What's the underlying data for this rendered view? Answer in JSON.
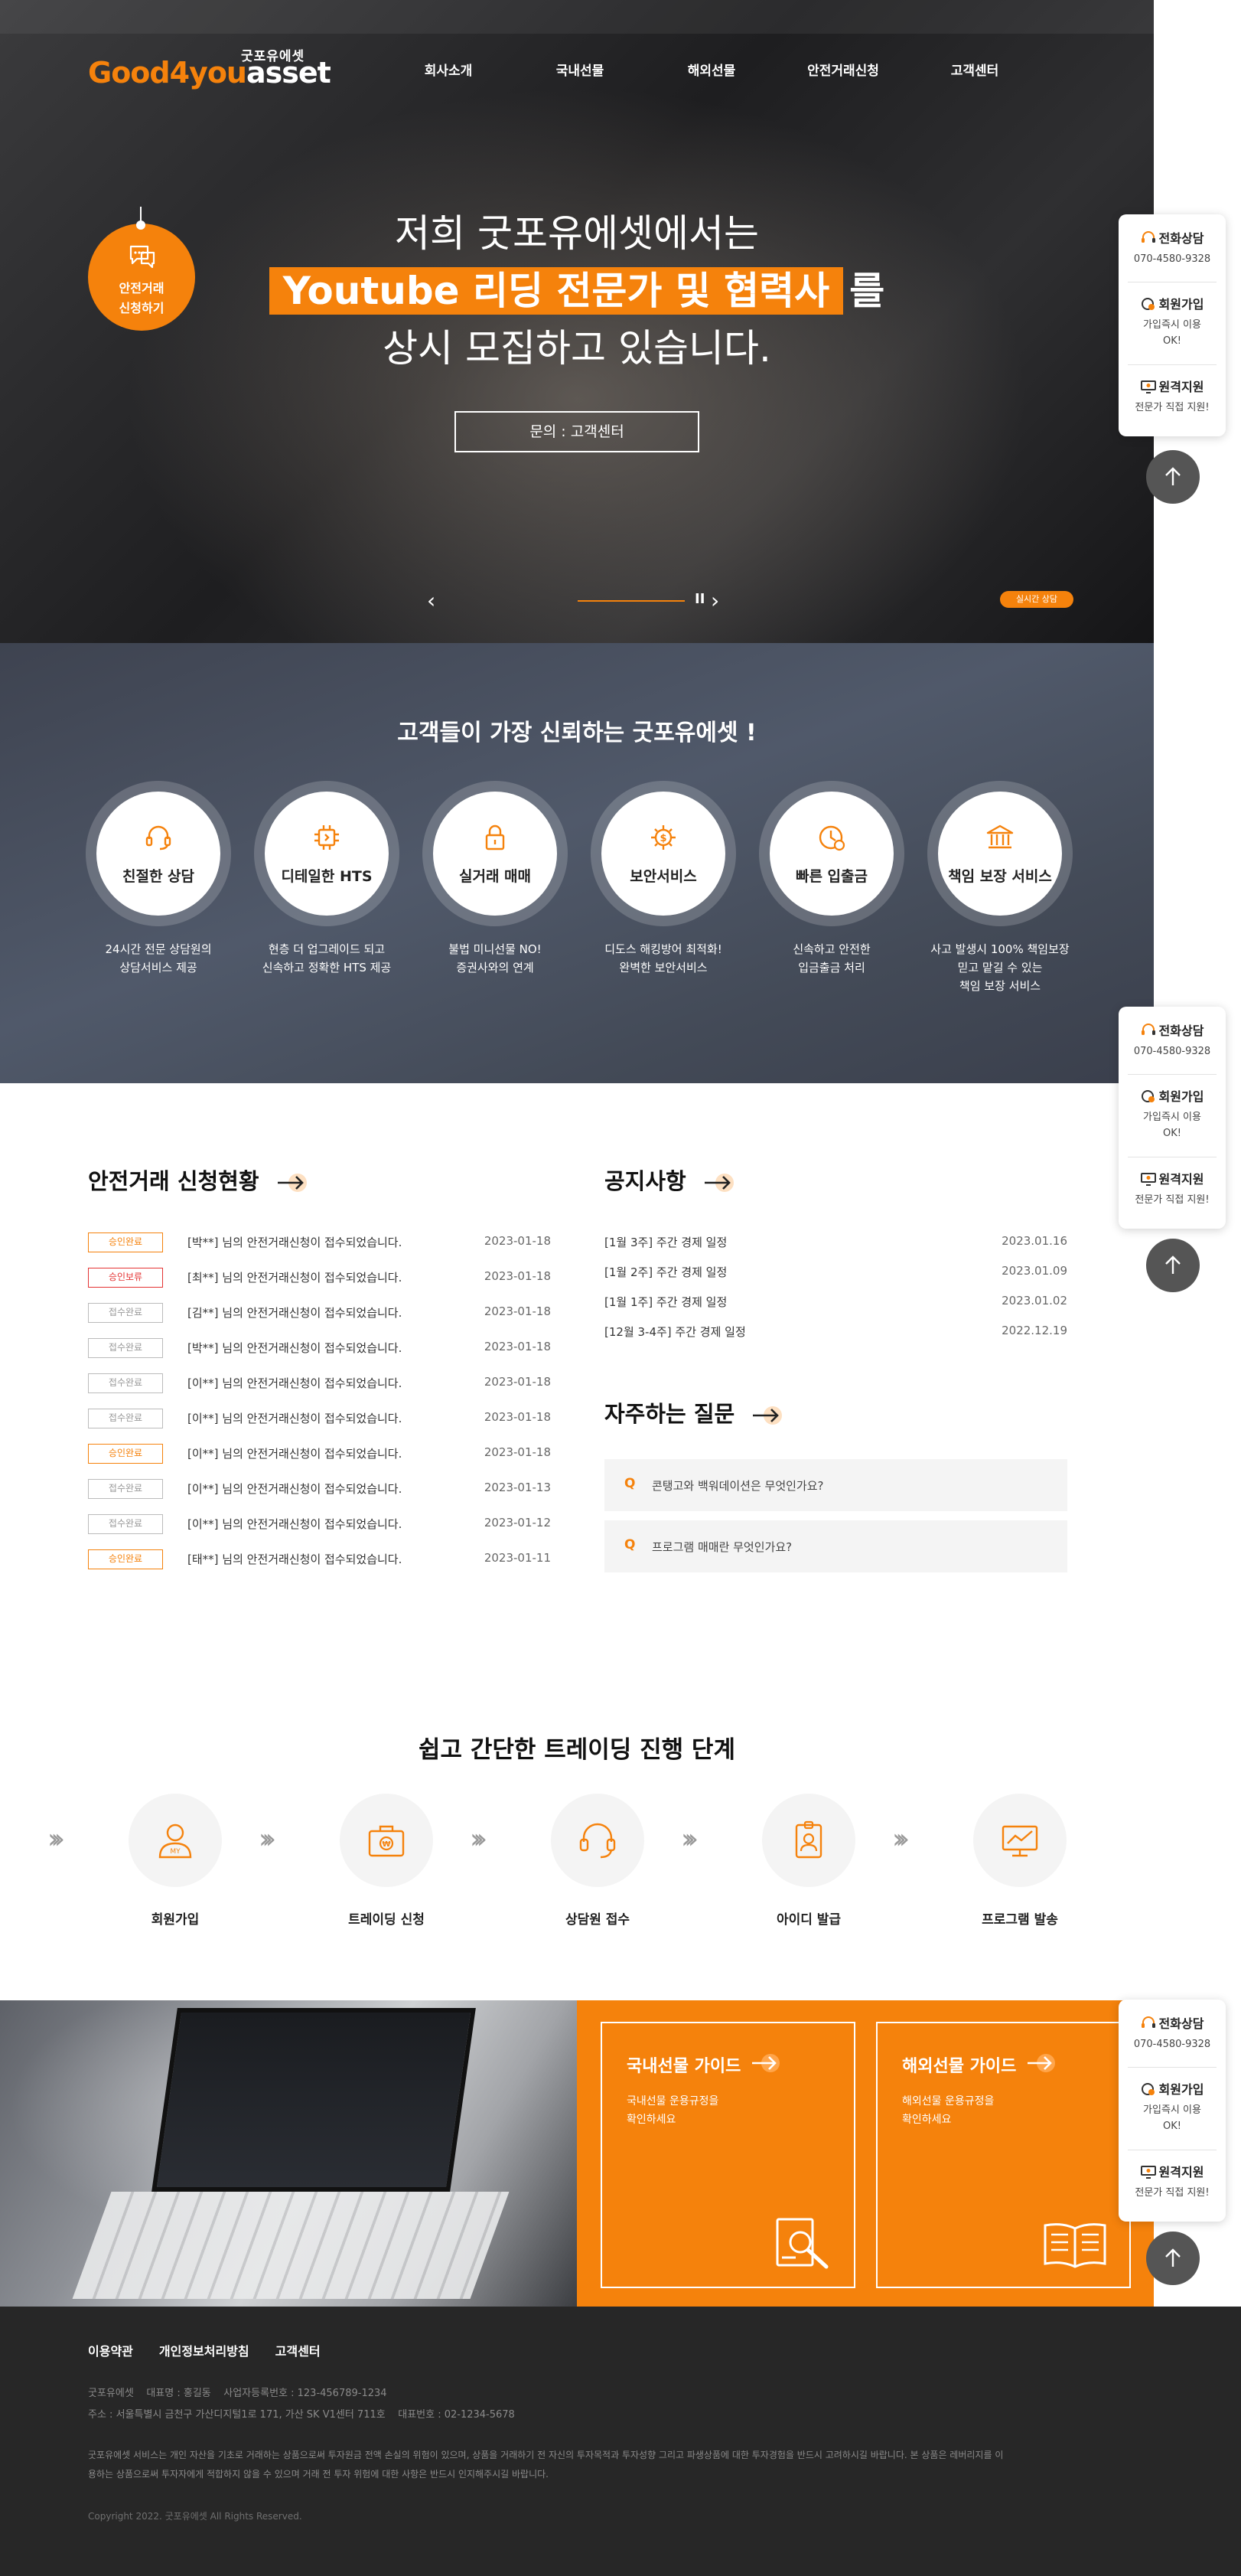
{
  "header": {
    "logo_ko": "굿포유에셋",
    "logo_en_a": "Good4you",
    "logo_en_b": "asset",
    "nav": [
      "회사소개",
      "국내선물",
      "해외선물",
      "안전거래신청",
      "고객센터"
    ]
  },
  "hero": {
    "apply_circle_line1": "안전거래",
    "apply_circle_line2": "신청하기",
    "line1": "저희 굿포유에셋에서는",
    "line2_highlight": "Youtube 리딩 전문가 및 협력사",
    "line2_tail": "를",
    "line3": "상시 모집하고 있습니다.",
    "button": "문의 : 고객센터",
    "prev": "‹",
    "next": "›",
    "pause": "II",
    "live_badge": "실시간 상담"
  },
  "trust": {
    "title": "고객들이 가장 신뢰하는 굿포유에셋 !",
    "features": [
      {
        "name": "친절한 상담",
        "icon": "headset-icon",
        "desc1": "24시간 전문 상담원의",
        "desc2": "상담서비스 제공",
        "desc3": ""
      },
      {
        "name": "디테일한 HTS",
        "icon": "chip-icon",
        "desc1": "현층 더 업그레이드 되고",
        "desc2": "신속하고 정확한 HTS 제공",
        "desc3": ""
      },
      {
        "name": "실거래 매매",
        "icon": "lock-icon",
        "desc1": "불법 미니선물 NO!",
        "desc2": "증권사와의 연계",
        "desc3": ""
      },
      {
        "name": "보안서비스",
        "icon": "coin-gear-icon",
        "desc1": "디도스 해킹방어 최적화!",
        "desc2": "완벽한 보안서비스",
        "desc3": ""
      },
      {
        "name": "빠른 입출금",
        "icon": "clock-icon",
        "desc1": "신속하고 안전한",
        "desc2": "입금출금 처리",
        "desc3": ""
      },
      {
        "name": "책임 보장 서비스",
        "icon": "bank-icon",
        "desc1": "사고 발생시 100% 책임보장",
        "desc2": "믿고 맡길 수 있는",
        "desc3": "책임 보장 서비스"
      }
    ]
  },
  "applications": {
    "title": "안전거래 신청현황",
    "rows": [
      {
        "status": "승인완료",
        "type": "approved",
        "text": "[박**] 님의 안전거래신청이 접수되었습니다.",
        "date": "2023-01-18"
      },
      {
        "status": "승인보류",
        "type": "held",
        "text": "[최**] 님의 안전거래신청이 접수되었습니다.",
        "date": "2023-01-18"
      },
      {
        "status": "접수완료",
        "type": "received",
        "text": "[김**] 님의 안전거래신청이 접수되었습니다.",
        "date": "2023-01-18"
      },
      {
        "status": "접수완료",
        "type": "received",
        "text": "[박**] 님의 안전거래신청이 접수되었습니다.",
        "date": "2023-01-18"
      },
      {
        "status": "접수완료",
        "type": "received",
        "text": "[이**] 님의 안전거래신청이 접수되었습니다.",
        "date": "2023-01-18"
      },
      {
        "status": "접수완료",
        "type": "received",
        "text": "[이**] 님의 안전거래신청이 접수되었습니다.",
        "date": "2023-01-18"
      },
      {
        "status": "승인완료",
        "type": "approved",
        "text": "[이**] 님의 안전거래신청이 접수되었습니다.",
        "date": "2023-01-18"
      },
      {
        "status": "접수완료",
        "type": "received",
        "text": "[이**] 님의 안전거래신청이 접수되었습니다.",
        "date": "2023-01-13"
      },
      {
        "status": "접수완료",
        "type": "received",
        "text": "[이**] 님의 안전거래신청이 접수되었습니다.",
        "date": "2023-01-12"
      },
      {
        "status": "승인완료",
        "type": "approved",
        "text": "[태**] 님의 안전거래신청이 접수되었습니다.",
        "date": "2023-01-11"
      }
    ]
  },
  "notices": {
    "title": "공지사항",
    "rows": [
      {
        "text": "[1월 3주] 주간 경제 일정",
        "date": "2023.01.16"
      },
      {
        "text": "[1월 2주] 주간 경제 일정",
        "date": "2023.01.09"
      },
      {
        "text": "[1월 1주] 주간 경제 일정",
        "date": "2023.01.02"
      },
      {
        "text": "[12월 3-4주] 주간 경제 일정",
        "date": "2022.12.19"
      }
    ]
  },
  "faq": {
    "title": "자주하는 질문",
    "q_mark": "Q",
    "items": [
      "콘탱고와 백워데이션은 무엇인가요?",
      "프로그램 매매란 무엇인가요?"
    ]
  },
  "steps": {
    "title": "쉽고 간단한 트레이딩 진행 단계",
    "chevron": "›››",
    "items": [
      "회원가입",
      "트레이딩 신청",
      "상담원 접수",
      "아이디 발급",
      "프로그램 발송"
    ]
  },
  "guides": [
    {
      "title": "국내선물 가이드",
      "desc1": "국내선물 운용규정을",
      "desc2": "확인하세요",
      "icon": "magnifier-document-icon"
    },
    {
      "title": "해외선물 가이드",
      "desc1": "해외선물 운용규정을",
      "desc2": "확인하세요",
      "icon": "open-book-icon"
    }
  ],
  "footer": {
    "links": [
      "이용약관",
      "개인정보처리방침",
      "고객센터"
    ],
    "line1": "굿포유에셋    대표명 : 홍길동    사업자등록번호 : 123-456789-1234",
    "line2": "주소 : 서울특별시 금천구 가산디지털1로 171, 가산 SK V1센터 711호    대표번호 : 02-1234-5678",
    "disclaimer1": "굿포유에셋 서비스는 개인 자산을 기초로 거래하는 상품으로써 투자원금 전액 손실의 위험이 있으며, 상품을 거래하기 전 자신의 투자목적과 투자성향 그리고 파생상품에 대한 투자경험을 반드시 고려하시길 바랍니다. 본 상품은 레버리지를 이",
    "disclaimer2": "용하는 상품으로써 투자자에게 적합하지 않을 수 있으며 거래 전 투자 위험에 대한 사항은 반드시 인지해주시길 바랍니다.",
    "copyright": "Copyright 2022. 굿포유에셋 All Rights Reserved."
  },
  "floating": {
    "phone_title": "전화상담",
    "phone_number": "070-4580-9328",
    "join_title": "회원가입",
    "join_desc1": "가입즉시 이용",
    "join_desc2": "OK!",
    "remote_title": "원격지원",
    "remote_desc": "전문가 직접 지원!"
  },
  "colors": {
    "accent": "#f5820c",
    "dark": "#272727",
    "held": "#e43333"
  }
}
